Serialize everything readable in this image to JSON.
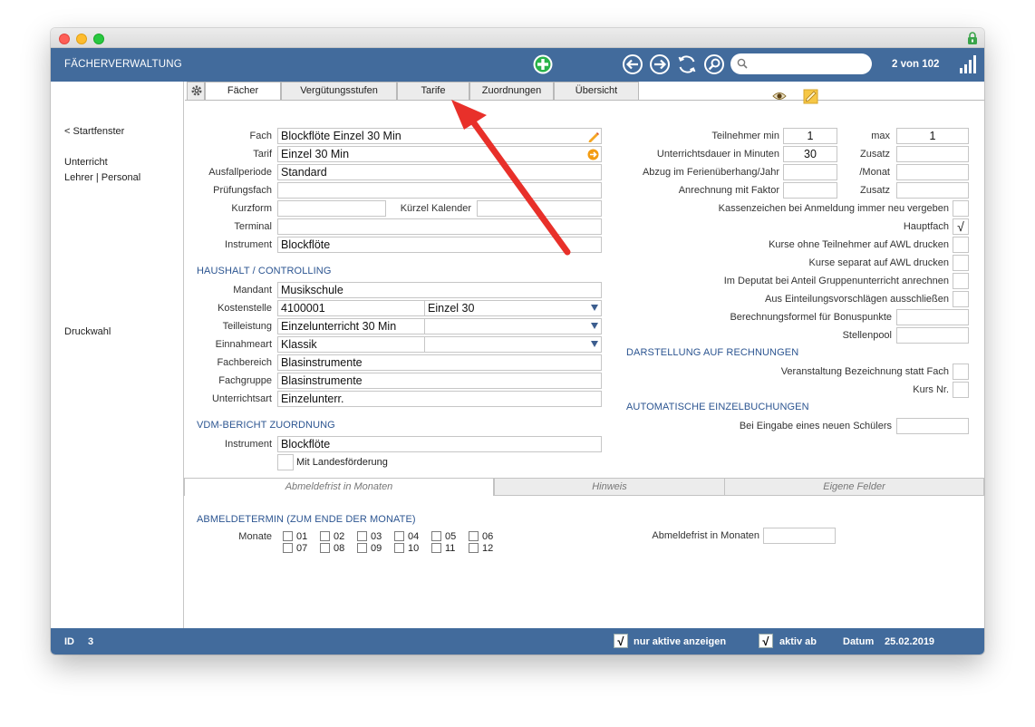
{
  "window": {
    "title": "FÄCHERVERWALTUNG",
    "record_count": "2 von 102"
  },
  "search": {
    "placeholder": "",
    "value": ""
  },
  "sidebar": {
    "back_link": "< Startfenster",
    "group1": "Unterricht",
    "group2": "Lehrer | Personal",
    "print": "Druckwahl"
  },
  "tabs": [
    "Fächer",
    "Vergütungsstufen",
    "Tarife",
    "Zuordnungen",
    "Übersicht"
  ],
  "form": {
    "fach_label": "Fach",
    "fach_value": "Blockflöte Einzel 30 Min",
    "tarif_label": "Tarif",
    "tarif_value": "Einzel 30 Min",
    "ausfall_label": "Ausfallperiode",
    "ausfall_value": "Standard",
    "pruef_label": "Prüfungsfach",
    "pruef_value": "",
    "kurzform_label": "Kurzform",
    "kurzform_value": "",
    "kuerzel_label": "Kürzel Kalender",
    "kuerzel_value": "",
    "terminal_label": "Terminal",
    "terminal_value": "",
    "instrument_label": "Instrument",
    "instrument_value": "Blockflöte"
  },
  "haushalt": {
    "title": "HAUSHALT / CONTROLLING",
    "mandant_label": "Mandant",
    "mandant_value": "Musikschule",
    "kosten_label": "Kostenstelle",
    "kosten_value": "4100001",
    "kosten_select": "Einzel 30",
    "teil_label": "Teilleistung",
    "teil_value": "Einzelunterricht 30 Min",
    "teil_select": "",
    "einnahme_label": "Einnahmeart",
    "einnahme_value": "Klassik",
    "einnahme_select": "",
    "fachbereich_label": "Fachbereich",
    "fachbereich_value": "Blasinstrumente",
    "fachgruppe_label": "Fachgruppe",
    "fachgruppe_value": "Blasinstrumente",
    "uart_label": "Unterrichtsart",
    "uart_value": "Einzelunterr."
  },
  "vdm": {
    "title": "VDM-BERICHT ZUORDNUNG",
    "instrument_label": "Instrument",
    "instrument_value": "Blockflöte",
    "landes_label": "Mit Landesförderung"
  },
  "right": {
    "tmin_label": "Teilnehmer min",
    "tmin_value": "1",
    "max_label": "max",
    "max_value": "1",
    "dauer_label": "Unterrichtsdauer in Minuten",
    "dauer_value": "30",
    "zusatz_label": "Zusatz",
    "zusatz_value": "",
    "abzug_label": "Abzug im Ferienüberhang/Jahr",
    "abzug_value": "",
    "monat_label": "/Monat",
    "monat_value": "",
    "anrechnung_label": "Anrechnung mit Faktor",
    "anrechnung_value": "",
    "zusatz2_label": "Zusatz",
    "zusatz2_value": "",
    "kassen_label": "Kassenzeichen bei Anmeldung immer neu vergeben",
    "haupt_label": "Hauptfach",
    "haupt_check": "√",
    "kurse_ohne_label": "Kurse ohne Teilnehmer auf AWL drucken",
    "kurse_sep_label": "Kurse separat auf AWL drucken",
    "deputat_label": "Im Deputat bei Anteil Gruppenunterricht anrechnen",
    "aus_label": "Aus Einteilungsvorschlägen ausschließen",
    "formel_label": "Berechnungsformel für Bonuspunkte",
    "formel_value": "",
    "stellen_label": "Stellenpool",
    "stellen_value": "",
    "darst_title": "DARSTELLUNG AUF RECHNUNGEN",
    "veranst_label": "Veranstaltung Bezeichnung statt Fach",
    "kursnr_label": "Kurs Nr.",
    "auto_title": "AUTOMATISCHE EINZELBUCHUNGEN",
    "eingabe_label": "Bei Eingabe eines neuen Schülers",
    "eingabe_value": ""
  },
  "subtabs": [
    "Abmeldefrist in Monaten",
    "Hinweis",
    "Eigene Felder"
  ],
  "abmeldung": {
    "title": "ABMELDETERMIN (ZUM ENDE DER MONATE)",
    "monate_label": "Monate",
    "months_row1": [
      "01",
      "02",
      "03",
      "04",
      "05",
      "06"
    ],
    "months_row2": [
      "07",
      "08",
      "09",
      "10",
      "11",
      "12"
    ],
    "frist_label": "Abmeldefrist in Monaten",
    "frist_value": ""
  },
  "status": {
    "id_label": "ID",
    "id_value": "3",
    "aktive_label": "nur aktive anzeigen",
    "aktiv_ab_label": "aktiv ab",
    "datum_label": "Datum",
    "datum_value": "25.02.2019",
    "check": "√"
  },
  "colors": {
    "toolbar": "#426b9c",
    "section": "#2c5591",
    "annotation_arrow": "#e8302a"
  },
  "icons": [
    "lock-icon",
    "add-icon",
    "back-icon",
    "forward-icon",
    "refresh-icon",
    "search-icon",
    "signal-icon",
    "gear-icon",
    "pencil-icon",
    "arrow-circle-icon",
    "eye-icon",
    "note-icon"
  ]
}
